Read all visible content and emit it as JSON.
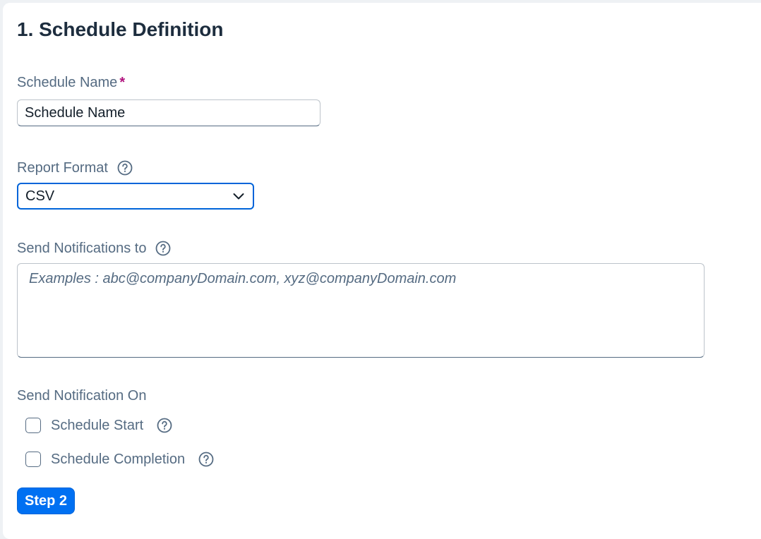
{
  "section": {
    "title": "1. Schedule Definition"
  },
  "schedule_name": {
    "label": "Schedule Name",
    "required_marker": "*",
    "value": "Schedule Name"
  },
  "report_format": {
    "label": "Report Format",
    "selected": "CSV"
  },
  "notifications": {
    "label": "Send Notifications to",
    "placeholder": "Examples : abc@companyDomain.com, xyz@companyDomain.com"
  },
  "notify_on": {
    "label": "Send Notification On",
    "options": [
      {
        "label": "Schedule Start",
        "checked": false
      },
      {
        "label": "Schedule Completion",
        "checked": false
      }
    ]
  },
  "actions": {
    "step_button": "Step 2"
  },
  "colors": {
    "accent": "#0070f2",
    "label_text": "#556b82",
    "title_text": "#1d2d3e",
    "required": "#b0127d"
  }
}
